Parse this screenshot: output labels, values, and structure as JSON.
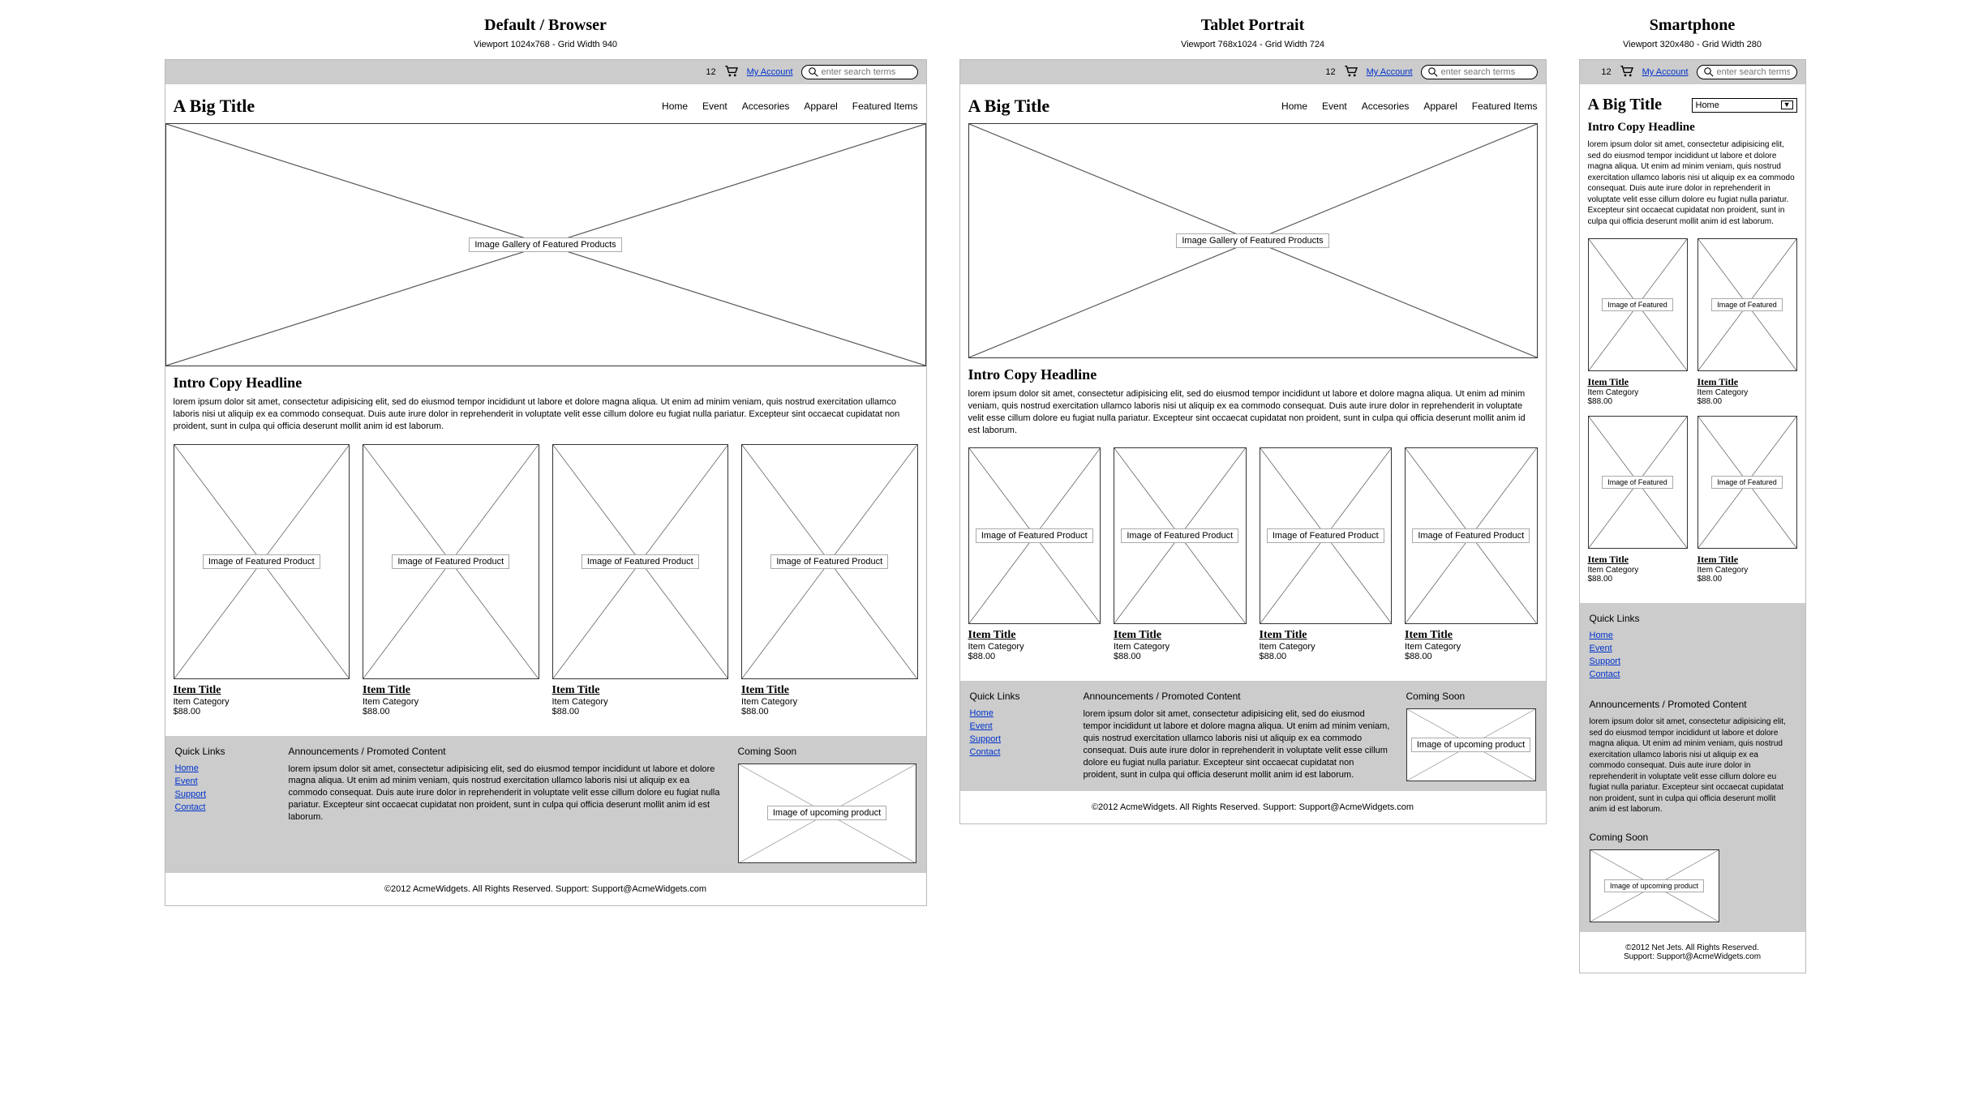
{
  "layouts": {
    "browser": {
      "title": "Default / Browser",
      "subtitle": "Viewport 1024x768 - Grid Width 940"
    },
    "tablet": {
      "title": "Tablet Portrait",
      "subtitle": "Viewport 768x1024 - Grid Width 724"
    },
    "phone": {
      "title": "Smartphone",
      "subtitle": "Viewport 320x480 - Grid Width 280"
    }
  },
  "utilbar": {
    "cart_count": "12",
    "my_account": "My Account",
    "search_placeholder": "enter search terms"
  },
  "site_title": "A Big Title",
  "nav": [
    "Home",
    "Event",
    "Accesories",
    "Apparel",
    "Featured Items"
  ],
  "nav_selected": "Home",
  "hero_caption": "Image Gallery of Featured Products",
  "intro": {
    "headline": "Intro Copy Headline",
    "body": "lorem ipsum dolor sit amet, consectetur adipisicing elit, sed do eiusmod tempor incididunt ut labore et dolore magna aliqua. Ut enim ad minim veniam, quis nostrud exercitation ullamco laboris nisi ut aliquip ex ea commodo consequat. Duis aute irure dolor in reprehenderit in voluptate velit esse cillum dolore eu fugiat nulla pariatur. Excepteur sint occaecat cupidatat non proident, sunt in culpa qui officia deserunt mollit anim id est laborum."
  },
  "product_caption_long": "Image of Featured Product",
  "product_caption_short": "Image of Featured",
  "product": {
    "title": "Item Title",
    "category": "Item Category",
    "price": "$88.00"
  },
  "promo": {
    "quick_links_title": "Quick Links",
    "quick_links": [
      "Home",
      "Event",
      "Support",
      "Contact"
    ],
    "ann_title": "Announcements / Promoted Content",
    "ann_body": "lorem ipsum dolor sit amet, consectetur adipisicing elit, sed do eiusmod tempor incididunt ut labore et dolore magna aliqua. Ut enim ad minim veniam, quis nostrud exercitation ullamco laboris nisi ut aliquip ex ea commodo consequat. Duis aute irure dolor in reprehenderit in voluptate velit esse cillum dolore eu fugiat nulla pariatur. Excepteur sint occaecat cupidatat non proident, sunt in culpa qui officia deserunt mollit anim id est laborum.",
    "soon_title": "Coming Soon",
    "soon_caption": "Image of upcoming product"
  },
  "copyright": {
    "acme": "©2012 AcmeWidgets.   All Rights Reserved.   Support: Support@AcmeWidgets.com",
    "netjets_line1": "©2012 Net Jets.   All Rights Reserved.",
    "netjets_line2": "Support: Support@AcmeWidgets.com"
  }
}
